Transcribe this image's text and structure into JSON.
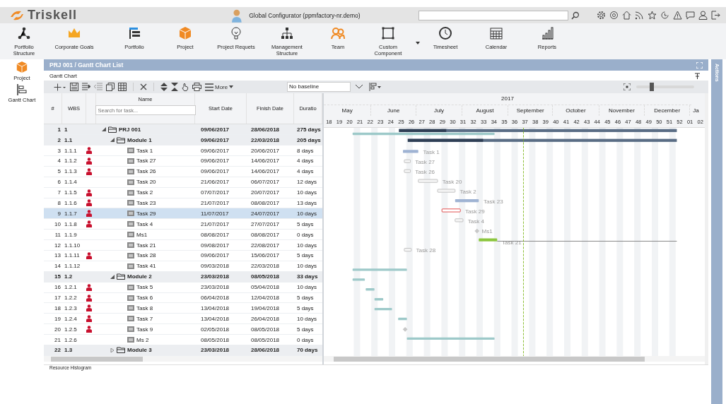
{
  "header": {
    "brand": "Triskell",
    "user": "Global Configurator (ppmfactory-nr.demo)"
  },
  "nav": [
    {
      "label": "Portfolio Structure",
      "has_menu": false
    },
    {
      "label": "Corporate Goals",
      "has_menu": false
    },
    {
      "label": "Portfolio",
      "has_menu": false
    },
    {
      "label": "Project",
      "has_menu": false
    },
    {
      "label": "Project Requets",
      "has_menu": false
    },
    {
      "label": "Management Structure",
      "has_menu": false
    },
    {
      "label": "Team",
      "has_menu": false
    },
    {
      "label": "Custom Component",
      "has_menu": true
    },
    {
      "label": "Timesheet",
      "has_menu": false
    },
    {
      "label": "Calendar",
      "has_menu": false
    },
    {
      "label": "Reports",
      "has_menu": false
    }
  ],
  "sidebar": {
    "items": [
      {
        "label": "Project"
      },
      {
        "label": "Gantt Chart"
      }
    ]
  },
  "panel": {
    "title": "PRJ 001 / Gantt Chart List",
    "tab": "Gantt Chart",
    "more": "More",
    "baseline": "No baseline",
    "zoom": {
      "level": 0.27
    },
    "footer": "Resource Histogram",
    "actions": "Actions"
  },
  "table": {
    "columns": [
      "#",
      "WBS",
      "Name",
      "Start Date",
      "Finish Date",
      "Duratio"
    ],
    "search_placeholder": "Search for task...",
    "rows": [
      {
        "num": "1",
        "wbs": "1",
        "name": "PRJ 001",
        "start": "09/06/2017",
        "finish": "28/06/2018",
        "duration": "275 days",
        "kind": "summary",
        "expanded": true,
        "resource": false,
        "selected": false,
        "bars": [
          {
            "kind": "summary",
            "level": 0.17
          },
          {
            "kind": "baseline"
          }
        ],
        "children": [
          {
            "num": "2",
            "wbs": "1.1",
            "name": "Module 1",
            "start": "09/06/2017",
            "finish": "22/03/2018",
            "duration": "205 days",
            "kind": "summary",
            "expanded": true,
            "resource": false,
            "selected": false,
            "bars": [
              {
                "kind": "summary",
                "level": 0.28
              }
            ],
            "children": [
              {
                "num": "3",
                "wbs": "1.1.1",
                "name": "Task 1",
                "start": "09/06/2017",
                "finish": "20/06/2017",
                "duration": "8 days",
                "kind": "task",
                "resource": true,
                "selected": false,
                "bars": [
                  {
                    "kind": "planned",
                    "label": "Task 1"
                  }
                ]
              },
              {
                "num": "4",
                "wbs": "1.1.2",
                "name": "Task 27",
                "start": "09/06/2017",
                "finish": "14/06/2017",
                "duration": "4 days",
                "kind": "task",
                "resource": true,
                "selected": false,
                "bars": [
                  {
                    "kind": "outline",
                    "label": "Task 27"
                  }
                ]
              },
              {
                "num": "5",
                "wbs": "1.1.3",
                "name": "Task 26",
                "start": "09/06/2017",
                "finish": "14/06/2017",
                "duration": "4 days",
                "kind": "task",
                "resource": true,
                "selected": false,
                "bars": [
                  {
                    "kind": "outline",
                    "label": "Task 26"
                  }
                ]
              },
              {
                "num": "6",
                "wbs": "1.1.4",
                "name": "Task 20",
                "start": "21/06/2017",
                "finish": "06/07/2017",
                "duration": "12 days",
                "kind": "task",
                "resource": false,
                "selected": false,
                "bars": [
                  {
                    "kind": "outline",
                    "label": "Task 20"
                  }
                ]
              },
              {
                "num": "7",
                "wbs": "1.1.5",
                "name": "Task 2",
                "start": "07/07/2017",
                "finish": "20/07/2017",
                "duration": "10 days",
                "kind": "task",
                "resource": true,
                "selected": false,
                "bars": [
                  {
                    "kind": "outline",
                    "label": "Task 2"
                  }
                ]
              },
              {
                "num": "8",
                "wbs": "1.1.6",
                "name": "Task 23",
                "start": "21/07/2017",
                "finish": "08/08/2017",
                "duration": "13 days",
                "kind": "task",
                "resource": true,
                "selected": false,
                "bars": [
                  {
                    "kind": "planned",
                    "label": "Task 23"
                  }
                ]
              },
              {
                "num": "9",
                "wbs": "1.1.7",
                "name": "Task 29",
                "start": "11/07/2017",
                "finish": "24/07/2017",
                "duration": "10 days",
                "kind": "task",
                "resource": true,
                "selected": true,
                "bars": [
                  {
                    "kind": "critical",
                    "label": "Task 29"
                  }
                ]
              },
              {
                "num": "10",
                "wbs": "1.1.8",
                "name": "Task 4",
                "start": "21/07/2017",
                "finish": "27/07/2017",
                "duration": "5 days",
                "kind": "task",
                "resource": true,
                "selected": false,
                "bars": [
                  {
                    "kind": "outline",
                    "label": "Task 4"
                  }
                ]
              },
              {
                "num": "11",
                "wbs": "1.1.9",
                "name": "Ms1",
                "start": "08/08/2017",
                "finish": "08/08/2017",
                "duration": "0 days",
                "kind": "task",
                "resource": false,
                "selected": false,
                "bars": [
                  {
                    "kind": "milestone",
                    "label": "Ms1"
                  }
                ]
              },
              {
                "num": "12",
                "wbs": "1.1.10",
                "name": "Task 21",
                "start": "09/08/2017",
                "finish": "22/08/2017",
                "duration": "10 days",
                "kind": "task",
                "resource": false,
                "selected": false,
                "bars": [
                  {
                    "kind": "done",
                    "label": "Task 21"
                  },
                  {
                    "kind": "line"
                  }
                ]
              },
              {
                "num": "13",
                "wbs": "1.1.11",
                "name": "Task 28",
                "start": "09/06/2017",
                "finish": "15/06/2017",
                "duration": "5 days",
                "kind": "task",
                "resource": true,
                "selected": false,
                "bars": [
                  {
                    "kind": "outline",
                    "label": "Task 28"
                  }
                ]
              },
              {
                "num": "14",
                "wbs": "1.1.12",
                "name": "Task 41",
                "start": "09/03/2018",
                "finish": "22/03/2018",
                "duration": "10 days",
                "kind": "task",
                "resource": false,
                "selected": false
              }
            ]
          },
          {
            "num": "15",
            "wbs": "1.2",
            "name": "Module 2",
            "start": "23/03/2018",
            "finish": "08/05/2018",
            "duration": "33 days",
            "kind": "summary",
            "expanded": true,
            "resource": false,
            "selected": false,
            "bars": [
              {
                "kind": "baseline"
              }
            ],
            "children": [
              {
                "num": "16",
                "wbs": "1.2.1",
                "name": "Task 5",
                "start": "23/03/2018",
                "finish": "05/04/2018",
                "duration": "10 days",
                "kind": "task",
                "resource": true,
                "selected": false,
                "bars": [
                  {
                    "kind": "baseline"
                  }
                ]
              },
              {
                "num": "17",
                "wbs": "1.2.2",
                "name": "Task 6",
                "start": "06/04/2018",
                "finish": "12/04/2018",
                "duration": "5 days",
                "kind": "task",
                "resource": true,
                "selected": false,
                "bars": [
                  {
                    "kind": "baseline"
                  }
                ]
              },
              {
                "num": "18",
                "wbs": "1.2.3",
                "name": "Task 8",
                "start": "13/04/2018",
                "finish": "19/04/2018",
                "duration": "5 days",
                "kind": "task",
                "resource": true,
                "selected": false,
                "bars": [
                  {
                    "kind": "baseline"
                  }
                ]
              },
              {
                "num": "19",
                "wbs": "1.2.4",
                "name": "Task 7",
                "start": "13/04/2018",
                "finish": "26/04/2018",
                "duration": "10 days",
                "kind": "task",
                "resource": true,
                "selected": false,
                "bars": [
                  {
                    "kind": "baseline"
                  }
                ]
              },
              {
                "num": "20",
                "wbs": "1.2.5",
                "name": "Task 9",
                "start": "02/05/2018",
                "finish": "08/05/2018",
                "duration": "5 days",
                "kind": "task",
                "resource": true,
                "selected": false,
                "bars": [
                  {
                    "kind": "baseline"
                  }
                ]
              },
              {
                "num": "21",
                "wbs": "1.2.6",
                "name": "Ms 2",
                "start": "08/05/2018",
                "finish": "08/05/2018",
                "duration": "0 days",
                "kind": "task",
                "resource": false,
                "selected": false,
                "bars": [
                  {
                    "kind": "milestone"
                  }
                ]
              }
            ]
          },
          {
            "num": "22",
            "wbs": "1.3",
            "name": "Module 3",
            "start": "23/03/2018",
            "finish": "28/06/2018",
            "duration": "70 days",
            "kind": "summary",
            "expanded": false,
            "resource": false,
            "selected": false,
            "bars": [
              {
                "kind": "baseline"
              }
            ]
          }
        ]
      }
    ]
  },
  "gantt": {
    "year": "2017",
    "months": [
      "May",
      "June",
      "July",
      "August",
      "September",
      "October",
      "November",
      "December",
      "Ja"
    ],
    "weeks": [
      "18",
      "19",
      "20",
      "21",
      "22",
      "23",
      "24",
      "25",
      "26",
      "27",
      "28",
      "29",
      "30",
      "31",
      "32",
      "33",
      "34",
      "35",
      "36",
      "37",
      "38",
      "39",
      "40",
      "41",
      "42",
      "43",
      "44",
      "45",
      "46",
      "47",
      "48",
      "49",
      "50",
      "51",
      "52",
      "01",
      "02"
    ]
  }
}
